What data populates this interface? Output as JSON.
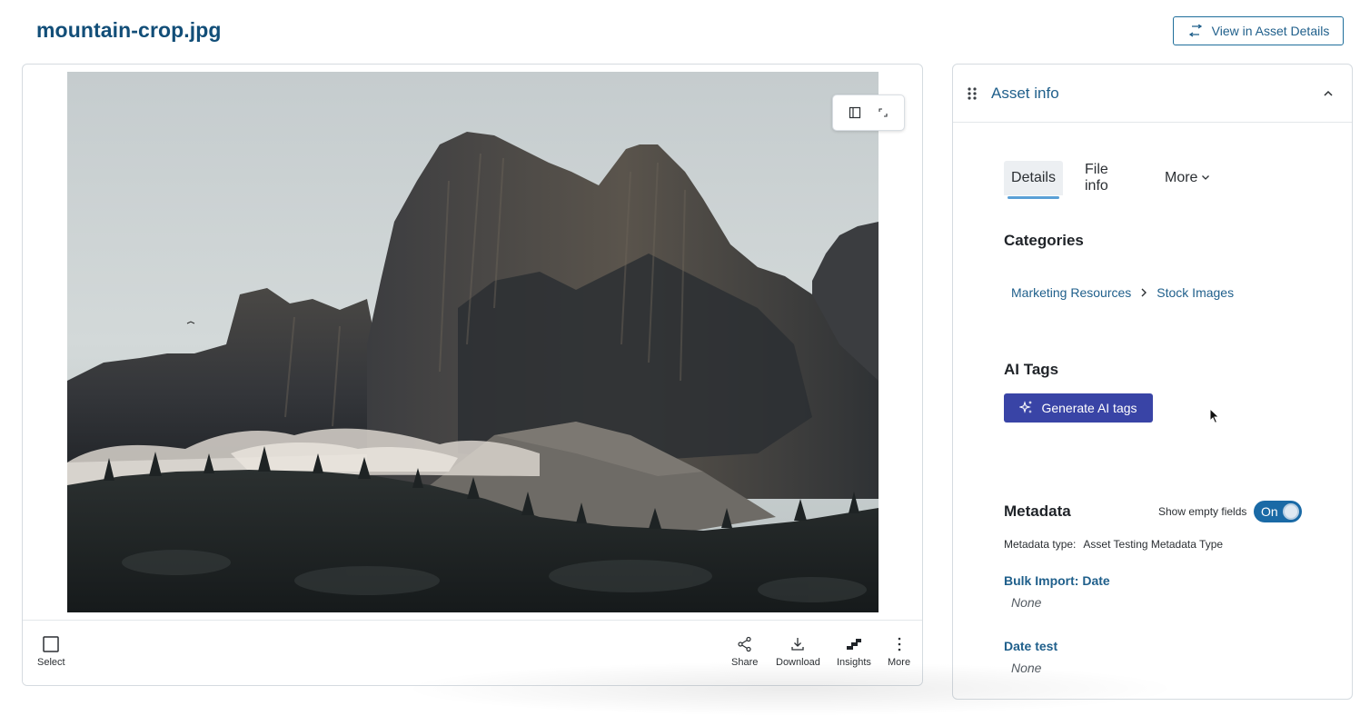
{
  "header": {
    "title": "mountain-crop.jpg",
    "view_details_label": "View in Asset Details"
  },
  "preview": {
    "image_alt": "Rocky mountain peaks with low clouds",
    "view_controls": [
      "panel-icon",
      "fit-screen-icon"
    ],
    "toolbar": {
      "select_label": "Select",
      "share_label": "Share",
      "download_label": "Download",
      "insights_label": "Insights",
      "more_label": "More"
    }
  },
  "panel": {
    "title": "Asset info",
    "tabs": [
      {
        "label": "Details",
        "active": true
      },
      {
        "label": "File info",
        "active": false
      },
      {
        "label": "More",
        "active": false
      }
    ],
    "categories": {
      "heading": "Categories",
      "path": [
        "Marketing Resources",
        "Stock Images"
      ]
    },
    "ai_tags": {
      "heading": "AI Tags",
      "button_label": "Generate AI tags"
    },
    "metadata": {
      "heading": "Metadata",
      "show_empty_label": "Show empty fields",
      "toggle_label": "On",
      "type_label": "Metadata type:",
      "type_value": "Asset Testing Metadata Type",
      "fields": [
        {
          "label": "Bulk Import: Date",
          "value": "None"
        },
        {
          "label": "Date test",
          "value": "None"
        }
      ]
    }
  },
  "colors": {
    "title": "#124e78",
    "link": "#1f5f8b",
    "primary_button": "#3944a6",
    "toggle_on": "#1a6aa6"
  }
}
